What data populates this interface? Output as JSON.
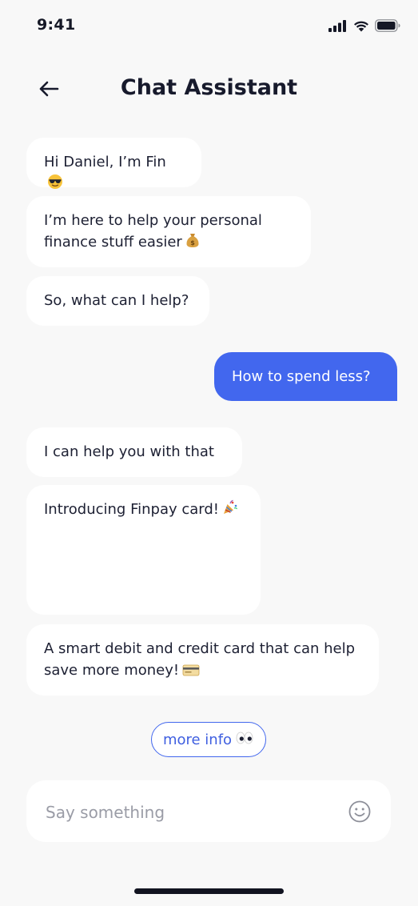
{
  "status_bar": {
    "time": "9:41"
  },
  "header": {
    "title": "Chat Assistant"
  },
  "messages": {
    "m1": "Hi Daniel, I’m Fin",
    "m2_line1": "I’m here to help your personal",
    "m2_line2": "finance stuff easier",
    "m3": "So, what can I help?",
    "user1": "How to spend less?",
    "m4": "I can help you with that",
    "m5": "Introducing Finpay card!",
    "m6_line1": "A smart debit and credit card that can help",
    "m6_line2": "save more money!"
  },
  "actions": {
    "more_info_label": "more info"
  },
  "composer": {
    "placeholder": "Say something"
  },
  "icons": {
    "sunglasses": "sunglasses-emoji-icon",
    "money_bag": "money-bag-emoji-icon",
    "party": "party-popper-emoji-icon",
    "card": "credit-card-emoji-icon",
    "eyes": "eyes-emoji-icon",
    "smile": "smile-icon",
    "back": "back-arrow-icon"
  },
  "colors": {
    "accent": "#4267ee",
    "background": "#f8f8f8",
    "bubble": "#ffffff",
    "text": "#1d2033",
    "placeholder": "#9a9ca6"
  }
}
